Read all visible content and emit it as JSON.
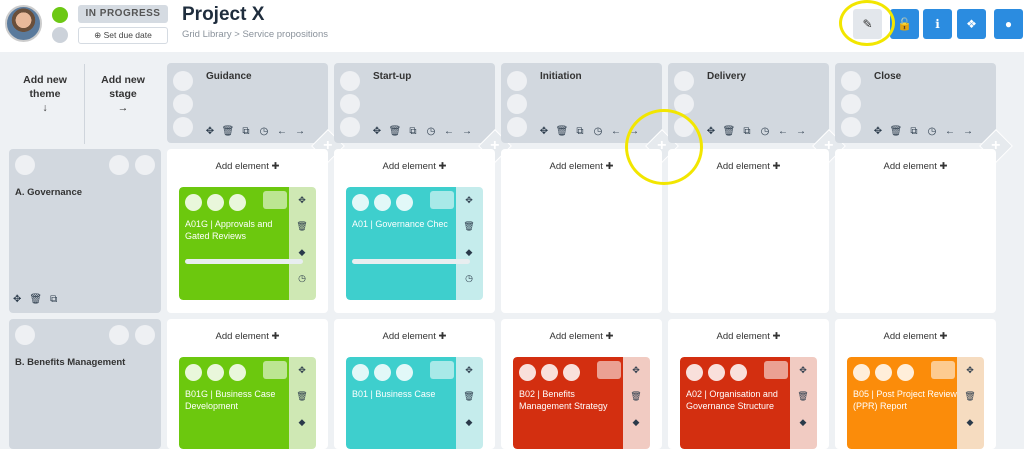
{
  "header": {
    "status": "IN PROGRESS",
    "due_label": "⊕ Set due date",
    "title": "Project X",
    "breadcrumb": "Grid Library > Service propositions",
    "buttons": [
      {
        "name": "edit-button",
        "icon": "pencil-icon",
        "glyph": "✎"
      },
      {
        "name": "unlock-button",
        "icon": "unlock-icon",
        "glyph": "🔓"
      },
      {
        "name": "info-button",
        "icon": "info-icon",
        "glyph": "ℹ"
      },
      {
        "name": "tags-button",
        "icon": "tags-icon",
        "glyph": "❖"
      },
      {
        "name": "comments-button",
        "icon": "comment-icon",
        "glyph": "●"
      }
    ]
  },
  "left_controls": {
    "add_theme": "Add new theme",
    "add_theme_arrow": "↓",
    "add_stage": "Add new stage",
    "add_stage_arrow": "→"
  },
  "stages": [
    {
      "name": "Guidance"
    },
    {
      "name": "Start-up"
    },
    {
      "name": "Initiation"
    },
    {
      "name": "Delivery"
    },
    {
      "name": "Close"
    }
  ],
  "stage_tool_glyphs": [
    "✥",
    "🗑",
    "⧉",
    "◷",
    "←",
    "→"
  ],
  "add_element_label": "Add element ✚",
  "themes": [
    {
      "name": "A. Governance",
      "cards": [
        {
          "stage": 0,
          "text": "A01G | Approvals and Gated Reviews",
          "color": "#6cc80e",
          "side": "#cfe8b4",
          "progress": true
        },
        {
          "stage": 1,
          "text": "A01 | Governance Chec",
          "color": "#3ecfcd",
          "side": "#c5ecec",
          "progress": true
        }
      ]
    },
    {
      "name": "B. Benefits Management",
      "cards": [
        {
          "stage": 0,
          "text": "B01G | Business Case Development",
          "color": "#6cc80e",
          "side": "#cfe8b4"
        },
        {
          "stage": 1,
          "text": "B01 | Business Case",
          "color": "#3ecfcd",
          "side": "#c5ecec"
        },
        {
          "stage": 2,
          "text": "B02 | Benefits Management Strategy",
          "color": "#d32f10",
          "side": "#f1cbc2"
        },
        {
          "stage": 3,
          "text": "A02 | Organisation and Governance Structure",
          "color": "#d32f10",
          "side": "#f1cbc2"
        },
        {
          "stage": 4,
          "text": "B05 | Post Project Review (PPR) Report",
          "color": "#fb8c0a",
          "side": "#f6dcc0"
        }
      ]
    }
  ],
  "colors": {
    "accent": "#2b8ce0",
    "highlight": "#f2e600"
  }
}
